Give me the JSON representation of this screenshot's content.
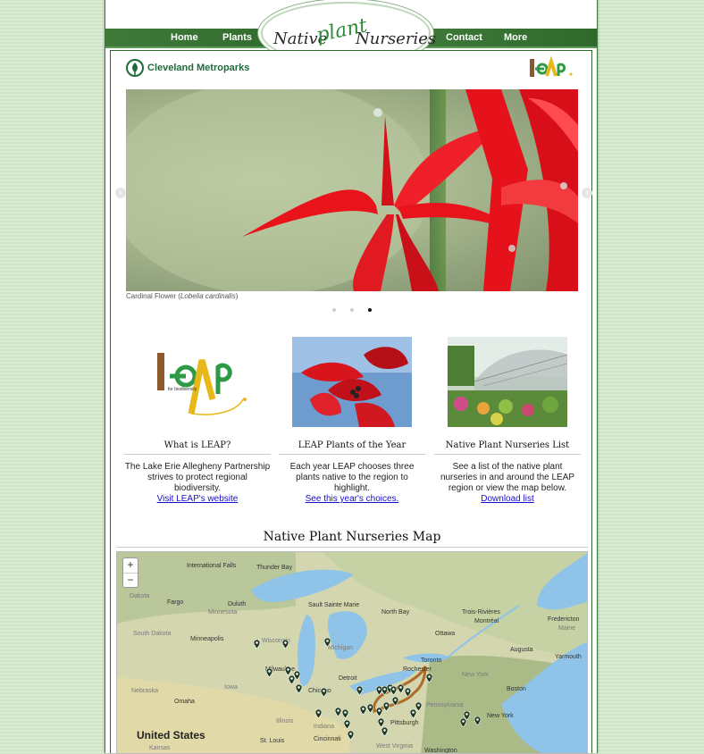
{
  "nav": {
    "home": "Home",
    "plants": "Plants",
    "contact": "Contact",
    "more": "More"
  },
  "logo": {
    "word1": "Native",
    "word2": "Nurseries",
    "word3": "plant"
  },
  "brand": {
    "cleveland": "Cleveland Metroparks"
  },
  "slider": {
    "caption_prefix": "Cardinal Flower (",
    "caption_species": "Lobelia cardinalis",
    "caption_suffix": ")",
    "dot_count": 3,
    "active_dot": 3
  },
  "columns": [
    {
      "title": "What is LEAP?",
      "body": "The Lake Erie Allegheny Partnership strives to protect regional biodiversity.",
      "link": "Visit LEAP's website"
    },
    {
      "title": "LEAP Plants of the Year",
      "body": "Each year LEAP chooses three plants native to the region to highlight.",
      "link": "See this year's choices."
    },
    {
      "title": "Native Plant Nurseries List",
      "body": "See a list of the native plant nurseries in and around the LEAP region or view the map below.",
      "link": "Download list"
    }
  ],
  "leap_logo": {
    "letters": "leAp",
    "tag": "for biodiversity"
  },
  "map": {
    "title": "Native Plant Nurseries Map",
    "zoom_in": "+",
    "zoom_out": "−",
    "labels": [
      "International Falls",
      "Thunder Bay",
      "Dakota",
      "Fargo",
      "Duluth",
      "Minnesota",
      "Sault Sainte Marie",
      "North Bay",
      "Trois-Rivières",
      "Montréal",
      "Fredericton",
      "South Dakota",
      "Minneapolis",
      "Wisconsin",
      "Michigan",
      "Ottawa",
      "Maine",
      "Augusta",
      "Yarmouth",
      "Toronto",
      "Rochester",
      "Milwaukee",
      "Detroit",
      "Iowa",
      "Chicago",
      "New York",
      "Boston",
      "Nebraska",
      "Omaha",
      "Pennsylvania",
      "New York",
      "Pittsburgh",
      "United States",
      "Illinois",
      "Indiana",
      "Kansas",
      "St. Louis",
      "Cincinnati",
      "West Virginia",
      "Washington"
    ]
  },
  "colors": {
    "nav_green": "#2f6a2c",
    "link_blue": "#1a0dcc",
    "cardinal_red": "#e8131b",
    "lake_blue": "#8fc4e8"
  }
}
